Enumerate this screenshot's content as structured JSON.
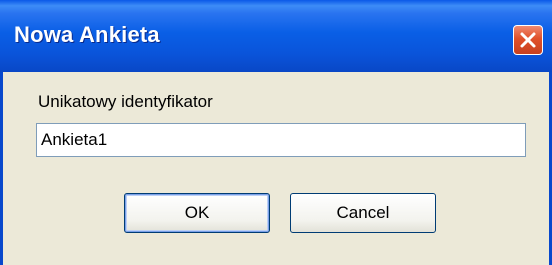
{
  "window": {
    "title": "Nowa Ankieta",
    "close_icon": "close-x-icon"
  },
  "form": {
    "field_label": "Unikatowy identyfikator",
    "field_value": "Ankieta1"
  },
  "buttons": {
    "ok_label": "OK",
    "cancel_label": "Cancel"
  },
  "colors": {
    "titlebar": "#0a5fe6",
    "dialog_bg": "#ece9d8",
    "close_button": "#e0502a"
  }
}
